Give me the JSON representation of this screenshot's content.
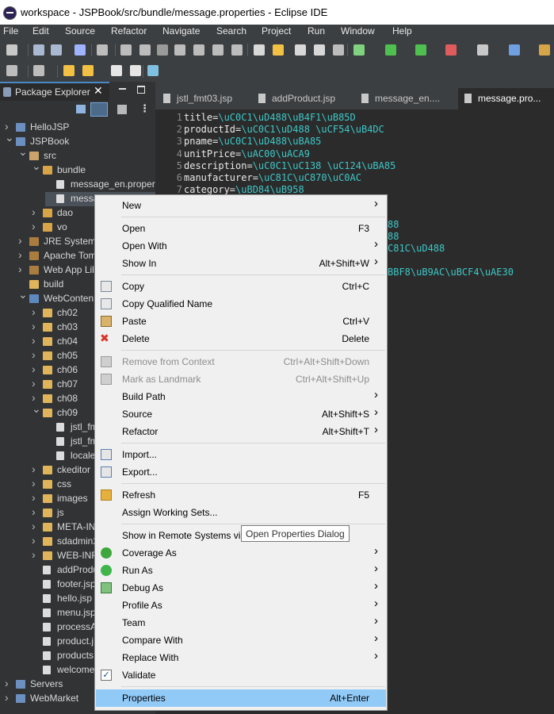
{
  "window": {
    "title": "workspace - JSPBook/src/bundle/message.properties - Eclipse IDE"
  },
  "menubar": [
    "File",
    "Edit",
    "Source",
    "Refactor",
    "Navigate",
    "Search",
    "Project",
    "Run",
    "Window",
    "Help"
  ],
  "explorer": {
    "title": "Package Explorer",
    "items": [
      {
        "label": "HelloJSP",
        "depth": 0,
        "twisty": ">",
        "icon": "project"
      },
      {
        "label": "JSPBook",
        "depth": 0,
        "twisty": "v",
        "icon": "project"
      },
      {
        "label": "src",
        "depth": 1,
        "twisty": "v",
        "icon": "src"
      },
      {
        "label": "bundle",
        "depth": 2,
        "twisty": "v",
        "icon": "pkg"
      },
      {
        "label": "message_en.propert",
        "depth": 3,
        "twisty": "",
        "icon": "file"
      },
      {
        "label": "messa",
        "depth": 3,
        "twisty": "",
        "icon": "file"
      },
      {
        "label": "dao",
        "depth": 2,
        "twisty": ">",
        "icon": "pkg"
      },
      {
        "label": "vo",
        "depth": 2,
        "twisty": ">",
        "icon": "pkg"
      },
      {
        "label": "JRE System",
        "depth": 1,
        "twisty": ">",
        "icon": "lib"
      },
      {
        "label": "Apache Tom",
        "depth": 1,
        "twisty": ">",
        "icon": "lib"
      },
      {
        "label": "Web App Lil",
        "depth": 1,
        "twisty": ">",
        "icon": "lib"
      },
      {
        "label": "build",
        "depth": 1,
        "twisty": "",
        "icon": "folder"
      },
      {
        "label": "WebConten",
        "depth": 1,
        "twisty": "v",
        "icon": "web"
      },
      {
        "label": "ch02",
        "depth": 2,
        "twisty": ">",
        "icon": "folder"
      },
      {
        "label": "ch03",
        "depth": 2,
        "twisty": ">",
        "icon": "folder"
      },
      {
        "label": "ch04",
        "depth": 2,
        "twisty": ">",
        "icon": "folder"
      },
      {
        "label": "ch05",
        "depth": 2,
        "twisty": ">",
        "icon": "folder"
      },
      {
        "label": "ch06",
        "depth": 2,
        "twisty": ">",
        "icon": "folder"
      },
      {
        "label": "ch07",
        "depth": 2,
        "twisty": ">",
        "icon": "folder"
      },
      {
        "label": "ch08",
        "depth": 2,
        "twisty": ">",
        "icon": "folder"
      },
      {
        "label": "ch09",
        "depth": 2,
        "twisty": "v",
        "icon": "folder"
      },
      {
        "label": "jstl_fm",
        "depth": 3,
        "twisty": "",
        "icon": "file"
      },
      {
        "label": "jstl_fm",
        "depth": 3,
        "twisty": "",
        "icon": "file"
      },
      {
        "label": "locale",
        "depth": 3,
        "twisty": "",
        "icon": "file"
      },
      {
        "label": "ckeditor",
        "depth": 2,
        "twisty": ">",
        "icon": "folder"
      },
      {
        "label": "css",
        "depth": 2,
        "twisty": ">",
        "icon": "folder"
      },
      {
        "label": "images",
        "depth": 2,
        "twisty": ">",
        "icon": "folder"
      },
      {
        "label": "js",
        "depth": 2,
        "twisty": ">",
        "icon": "folder"
      },
      {
        "label": "META-IN",
        "depth": 2,
        "twisty": ">",
        "icon": "folder"
      },
      {
        "label": "sdadmin2",
        "depth": 2,
        "twisty": ">",
        "icon": "folder"
      },
      {
        "label": "WEB-INF",
        "depth": 2,
        "twisty": ">",
        "icon": "folder"
      },
      {
        "label": "addProdu",
        "depth": 2,
        "twisty": "",
        "icon": "file"
      },
      {
        "label": "footer.jsp",
        "depth": 2,
        "twisty": "",
        "icon": "file"
      },
      {
        "label": "hello.jsp",
        "depth": 2,
        "twisty": "",
        "icon": "file"
      },
      {
        "label": "menu.jsp",
        "depth": 2,
        "twisty": "",
        "icon": "file"
      },
      {
        "label": "processA",
        "depth": 2,
        "twisty": "",
        "icon": "file"
      },
      {
        "label": "product.j",
        "depth": 2,
        "twisty": "",
        "icon": "file"
      },
      {
        "label": "products.",
        "depth": 2,
        "twisty": "",
        "icon": "file"
      },
      {
        "label": "welcome",
        "depth": 2,
        "twisty": "",
        "icon": "file"
      },
      {
        "label": "Servers",
        "depth": 0,
        "twisty": ">",
        "icon": "project"
      },
      {
        "label": "WebMarket",
        "depth": 0,
        "twisty": ">",
        "icon": "project"
      }
    ]
  },
  "editor": {
    "tabs": [
      {
        "label": "jstl_fmt03.jsp",
        "active": false
      },
      {
        "label": "addProduct.jsp",
        "active": false
      },
      {
        "label": "message_en....",
        "active": false
      },
      {
        "label": "message.pro...",
        "active": true
      }
    ],
    "lines": [
      {
        "n": "1",
        "key": "title=",
        "val": "\\uC0C1\\uD488\\uB4F1\\uB85D"
      },
      {
        "n": "2",
        "key": "productId=",
        "val": "\\uC0C1\\uD488 \\uCF54\\uB4DC"
      },
      {
        "n": "3",
        "key": "pname=",
        "val": "\\uC0C1\\uD488\\uBA85"
      },
      {
        "n": "4",
        "key": "unitPrice=",
        "val": "\\uAC00\\uACA9"
      },
      {
        "n": "5",
        "key": "description=",
        "val": "\\uC0C1\\uC138 \\uC124\\uBA85"
      },
      {
        "n": "6",
        "key": "manufacturer=",
        "val": "\\uC81C\\uC870\\uC0AC"
      },
      {
        "n": "7",
        "key": "category=",
        "val": "\\uBD84\\uB958"
      }
    ],
    "partial_lines": [
      "88",
      "88",
      "C81C\\uD488",
      "BBF8\\uB9AC\\uBCF4\\uAE30"
    ]
  },
  "context_menu": {
    "items": [
      {
        "label": "New",
        "shortcut": "",
        "submenu": true,
        "icon": ""
      },
      {
        "sep": true
      },
      {
        "label": "Open",
        "shortcut": "F3",
        "submenu": false,
        "icon": ""
      },
      {
        "label": "Open With",
        "shortcut": "",
        "submenu": true,
        "icon": ""
      },
      {
        "label": "Show In",
        "shortcut": "Alt+Shift+W",
        "submenu": true,
        "icon": ""
      },
      {
        "sep": true
      },
      {
        "label": "Copy",
        "shortcut": "Ctrl+C",
        "submenu": false,
        "icon": "copy"
      },
      {
        "label": "Copy Qualified Name",
        "shortcut": "",
        "submenu": false,
        "icon": "copy-qualified"
      },
      {
        "label": "Paste",
        "shortcut": "Ctrl+V",
        "submenu": false,
        "icon": "paste"
      },
      {
        "label": "Delete",
        "shortcut": "Delete",
        "submenu": false,
        "icon": "delete"
      },
      {
        "sep": true
      },
      {
        "label": "Remove from Context",
        "shortcut": "Ctrl+Alt+Shift+Down",
        "submenu": false,
        "disabled": true,
        "icon": "remove-context"
      },
      {
        "label": "Mark as Landmark",
        "shortcut": "Ctrl+Alt+Shift+Up",
        "submenu": false,
        "disabled": true,
        "icon": "landmark"
      },
      {
        "label": "Build Path",
        "shortcut": "",
        "submenu": true,
        "icon": ""
      },
      {
        "label": "Source",
        "shortcut": "Alt+Shift+S",
        "submenu": true,
        "icon": ""
      },
      {
        "label": "Refactor",
        "shortcut": "Alt+Shift+T",
        "submenu": true,
        "icon": ""
      },
      {
        "sep": true
      },
      {
        "label": "Import...",
        "shortcut": "",
        "submenu": false,
        "icon": "import"
      },
      {
        "label": "Export...",
        "shortcut": "",
        "submenu": false,
        "icon": "export"
      },
      {
        "sep": true
      },
      {
        "label": "Refresh",
        "shortcut": "F5",
        "submenu": false,
        "icon": "refresh"
      },
      {
        "label": "Assign Working Sets...",
        "shortcut": "",
        "submenu": false,
        "icon": ""
      },
      {
        "sep": true
      },
      {
        "label": "Show in Remote Systems vi",
        "shortcut": "",
        "submenu": false,
        "icon": ""
      },
      {
        "label": "Coverage As",
        "shortcut": "",
        "submenu": true,
        "icon": "coverage"
      },
      {
        "label": "Run As",
        "shortcut": "",
        "submenu": true,
        "icon": "run"
      },
      {
        "label": "Debug As",
        "shortcut": "",
        "submenu": true,
        "icon": "debug"
      },
      {
        "label": "Profile As",
        "shortcut": "",
        "submenu": true,
        "icon": ""
      },
      {
        "label": "Team",
        "shortcut": "",
        "submenu": true,
        "icon": ""
      },
      {
        "label": "Compare With",
        "shortcut": "",
        "submenu": true,
        "icon": ""
      },
      {
        "label": "Replace With",
        "shortcut": "",
        "submenu": true,
        "icon": ""
      },
      {
        "label": "Validate",
        "shortcut": "",
        "submenu": false,
        "icon": "validate-check"
      },
      {
        "sep": true
      },
      {
        "label": "Properties",
        "shortcut": "Alt+Enter",
        "submenu": false,
        "selected": true,
        "icon": ""
      }
    ]
  },
  "tooltip": {
    "text": "Open Properties Dialog"
  },
  "colors": {
    "accent": "#91c9f7",
    "editor_bg": "#2b2b2b",
    "value_text": "#3ec7c7"
  }
}
